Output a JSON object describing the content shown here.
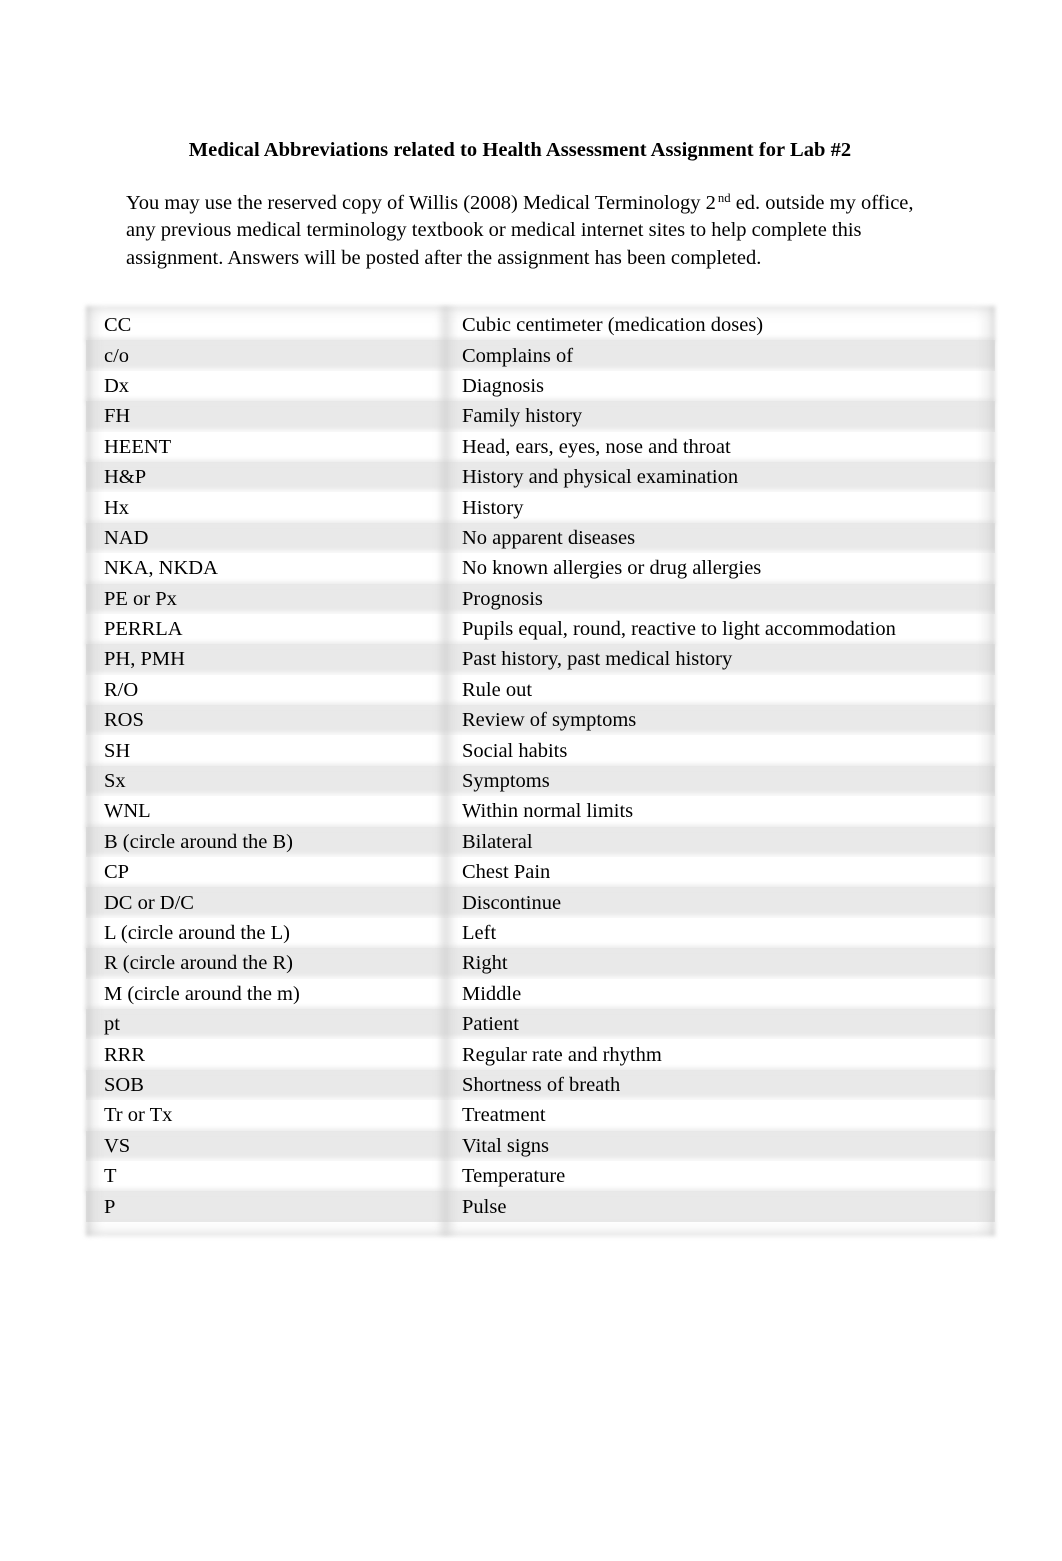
{
  "document": {
    "title": "Medical Abbreviations related to Health Assessment Assignment for Lab #2",
    "intro": {
      "part1": "You may use the reserved copy of Willis (2008) Medical Terminology 2",
      "superscript": "nd",
      "part2": " ed. outside my office, any previous medical terminology textbook or medical internet sites to help complete this assignment.  Answers will be posted after the assignment has been completed."
    }
  },
  "table": {
    "rows": [
      {
        "abbreviation": "CC",
        "meaning": "Cubic centimeter (medication doses)"
      },
      {
        "abbreviation": "c/o",
        "meaning": "Complains of"
      },
      {
        "abbreviation": "Dx",
        "meaning": "Diagnosis"
      },
      {
        "abbreviation": "FH",
        "meaning": "Family history"
      },
      {
        "abbreviation": "HEENT",
        "meaning": "Head, ears, eyes, nose and throat"
      },
      {
        "abbreviation": "H&P",
        "meaning": "History and physical examination"
      },
      {
        "abbreviation": "Hx",
        "meaning": "History"
      },
      {
        "abbreviation": "NAD",
        "meaning": "No apparent diseases"
      },
      {
        "abbreviation": "NKA, NKDA",
        "meaning": "No known allergies or drug allergies"
      },
      {
        "abbreviation": "PE or Px",
        "meaning": "Prognosis"
      },
      {
        "abbreviation": "PERRLA",
        "meaning": "Pupils equal, round, reactive to light accommodation"
      },
      {
        "abbreviation": "PH, PMH",
        "meaning": "Past history, past medical history"
      },
      {
        "abbreviation": "R/O",
        "meaning": "Rule out"
      },
      {
        "abbreviation": "ROS",
        "meaning": "Review of symptoms"
      },
      {
        "abbreviation": "SH",
        "meaning": "Social habits"
      },
      {
        "abbreviation": "Sx",
        "meaning": "Symptoms"
      },
      {
        "abbreviation": "WNL",
        "meaning": "Within normal limits"
      },
      {
        "abbreviation": "B (circle around the B)",
        "meaning": "Bilateral"
      },
      {
        "abbreviation": "CP",
        "meaning": "Chest Pain"
      },
      {
        "abbreviation": "DC or D/C",
        "meaning": "Discontinue"
      },
      {
        "abbreviation": "L (circle around the L)",
        "meaning": "Left"
      },
      {
        "abbreviation": "R (circle around the R)",
        "meaning": "Right"
      },
      {
        "abbreviation": "M (circle around the m)",
        "meaning": "Middle"
      },
      {
        "abbreviation": "pt",
        "meaning": "Patient"
      },
      {
        "abbreviation": "RRR",
        "meaning": "Regular rate and rhythm"
      },
      {
        "abbreviation": "SOB",
        "meaning": "Shortness of breath"
      },
      {
        "abbreviation": "Tr or Tx",
        "meaning": "Treatment"
      },
      {
        "abbreviation": "VS",
        "meaning": "Vital signs"
      },
      {
        "abbreviation": "T",
        "meaning": "Temperature"
      },
      {
        "abbreviation": "P",
        "meaning": "Pulse"
      }
    ]
  },
  "colors": {
    "page_background": "#ffffff",
    "row_stripe": "#e9e9e9",
    "row_alt": "#ffffff",
    "text": "#000000",
    "divider_shadow": "#c4c4c4"
  }
}
